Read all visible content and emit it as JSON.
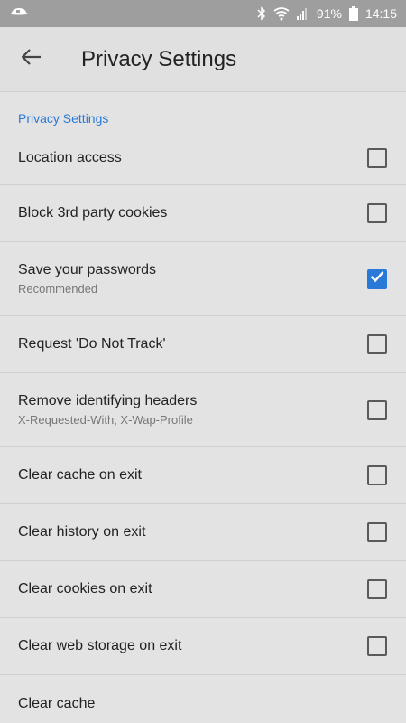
{
  "status": {
    "battery": "91%",
    "time": "14:15",
    "icons": [
      "app-notification-icon",
      "bluetooth-icon",
      "wifi-icon",
      "signal-icon",
      "battery-icon"
    ]
  },
  "appbar": {
    "back_icon": "arrow-left-icon",
    "title": "Privacy Settings"
  },
  "section": {
    "header": "Privacy Settings"
  },
  "items": [
    {
      "title": "Location access",
      "subtitle": "",
      "checked": false
    },
    {
      "title": "Block 3rd party cookies",
      "subtitle": "",
      "checked": false
    },
    {
      "title": "Save your passwords",
      "subtitle": "Recommended",
      "checked": true
    },
    {
      "title": "Request 'Do Not Track'",
      "subtitle": "",
      "checked": false
    },
    {
      "title": "Remove identifying headers",
      "subtitle": "X-Requested-With, X-Wap-Profile",
      "checked": false
    },
    {
      "title": "Clear cache on exit",
      "subtitle": "",
      "checked": false
    },
    {
      "title": "Clear history on exit",
      "subtitle": "",
      "checked": false
    },
    {
      "title": "Clear cookies on exit",
      "subtitle": "",
      "checked": false
    },
    {
      "title": "Clear web storage on exit",
      "subtitle": "",
      "checked": false
    },
    {
      "title": "Clear cache",
      "subtitle": "",
      "checked": null
    }
  ],
  "colors": {
    "accent": "#2979d9",
    "statusbar": "#9e9e9e",
    "background": "#e3e3e3"
  }
}
